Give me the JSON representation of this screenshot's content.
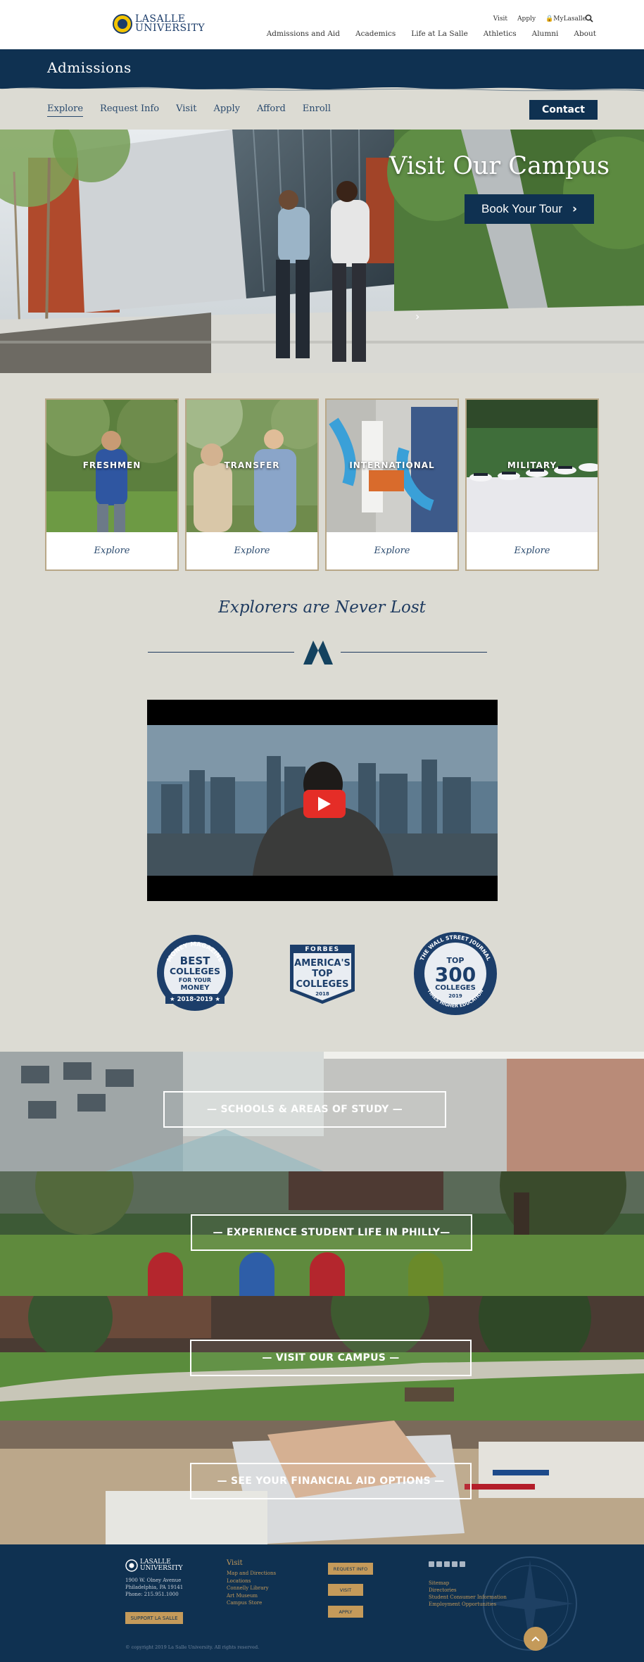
{
  "header": {
    "logo_line1": "LASALLE",
    "logo_line2": "UNIVERSITY",
    "utility": [
      "Visit",
      "Apply",
      "MyLasalle"
    ],
    "nav": [
      "Admissions and Aid",
      "Academics",
      "Life at La Salle",
      "Athletics",
      "Alumni",
      "About"
    ]
  },
  "section": {
    "title": "Admissions"
  },
  "subnav": {
    "items": [
      "Explore",
      "Request Info",
      "Visit",
      "Apply",
      "Afford",
      "Enroll"
    ],
    "contact_label": "Contact"
  },
  "hero": {
    "title": "Visit Our Campus",
    "button_label": "Book Your Tour"
  },
  "cards": [
    {
      "label": "FRESHMEN",
      "link": "Explore"
    },
    {
      "label": "TRANSFER",
      "link": "Explore"
    },
    {
      "label": "INTERNATIONAL",
      "link": "Explore"
    },
    {
      "label": "MILITARY",
      "link": "Explore"
    }
  ],
  "tagline": "Explorers are Never Lost",
  "badges": {
    "money": {
      "arc": "MONEY MAGAZINE",
      "l1": "BEST",
      "l2": "COLLEGES",
      "l3": "FOR YOUR",
      "l4": "MONEY",
      "year": "★ 2018-2019 ★"
    },
    "forbes": {
      "top": "FORBES",
      "l1": "AMERICA'S",
      "l2": "TOP",
      "l3": "COLLEGES",
      "year": "2018"
    },
    "wsj": {
      "arc": "THE WALL STREET JOURNAL",
      "l1": "TOP",
      "l2": "300",
      "l3": "COLLEGES",
      "year": "2019",
      "bottom": "TIMES HIGHER EDUCATION"
    }
  },
  "banners": [
    "— SCHOOLS & AREAS OF STUDY —",
    "— EXPERIENCE STUDENT LIFE IN PHILLY—",
    "— VISIT OUR CAMPUS —",
    "— SEE YOUR FINANCIAL AID OPTIONS —"
  ],
  "footer": {
    "logo_line1": "LASALLE",
    "logo_line2": "UNIVERSITY",
    "address": [
      "1900 W. Olney Avenue",
      "Philadelphia, PA 19141",
      "Phone: 215.951.1000"
    ],
    "support_label": "SUPPORT LA SALLE",
    "visit_heading": "Visit",
    "visit_links": [
      "Map and Directions",
      "Locations",
      "Connelly Library",
      "Art Museum",
      "Campus Store"
    ],
    "buttons": [
      "REQUEST INFO",
      "VISIT",
      "APPLY"
    ],
    "links": [
      "Sitemap",
      "Directories",
      "Student Consumer Information",
      "Employment Opportunities"
    ],
    "copyright": "© copyright 2019 La Salle University. All rights reserved."
  }
}
